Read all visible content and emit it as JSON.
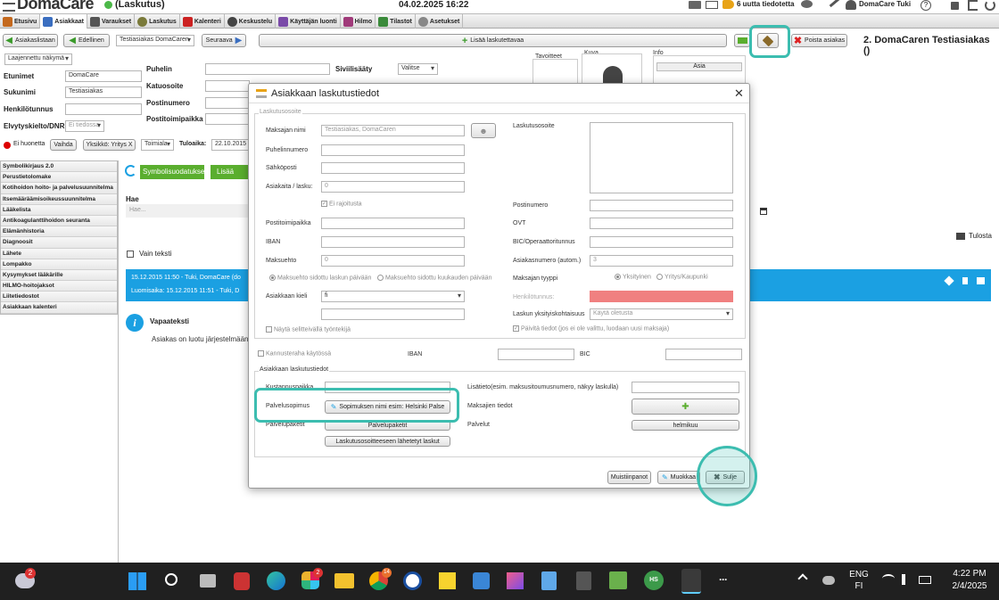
{
  "app": {
    "title": "DomaCare",
    "mode": "(Laskutus)",
    "datetime": "04.02.2025 16:22",
    "notifications": "6 uutta tiedotetta",
    "user": "DomaCare Tuki"
  },
  "tabs": [
    "Etusivu",
    "Asiakkaat",
    "Varaukset",
    "Laskutus",
    "Kalenteri",
    "Keskustelu",
    "Käyttäjän luonti",
    "Hilmo",
    "Tilastot",
    "Asetukset"
  ],
  "toolbar": {
    "back_list": "Asiakaslistaan",
    "prev": "Edellinen",
    "client_select": "Testiasiakas DomaCaren",
    "next": "Seuraava",
    "add_billable": "Lisää laskutettavaa",
    "remove_client": "Poista asiakas",
    "client_heading": "2. DomaCaren Testiasiakas ()"
  },
  "client": {
    "view_select": "Laajennettu näkymä",
    "labels": {
      "firstname": "Etunimet",
      "lastname": "Sukunimi",
      "ssn": "Henkilötunnus",
      "revival": "Elvytyskielto/DNR",
      "phone": "Puhelin",
      "street": "Katuosoite",
      "postcode": "Postinumero",
      "postoffice": "Postitoimipaikka",
      "marital": "Siviilisääty",
      "goals": "Tavoitteet",
      "image": "Kuva",
      "info": "Info"
    },
    "values": {
      "firstname": "DomaCare",
      "lastname": "Testiasiakas",
      "revival": "Ei tiedossa",
      "marital": "Valitse"
    },
    "info_col": "Asia",
    "concern": "Ei huonetta",
    "change_btn": "Vaihda",
    "unit": "Yksikkö: Yritys X",
    "office": "Toimiala",
    "arrival_label": "Tuloaika:",
    "arrival": "22.10.2015"
  },
  "sidebar": [
    "Symbolikirjaus 2.0",
    "Perustietolomake",
    "Kotihoidon hoito- ja palvelusuunnitelma",
    "Itsemääräämisoikeussuunnitelma",
    "Lääkelista",
    "Antikoagulanttihoidon seuranta",
    "Elämänhistoria",
    "Diagnoosit",
    "Lähete",
    "Lompakko",
    "Kysymykset lääkärille",
    "HILMO-hoitojaksot",
    "Liitetiedostot",
    "Asiakkaan kalenteri"
  ],
  "main": {
    "symbol_filter": "Symbolisuodatukset",
    "add_report": "Lisää rapo",
    "search_label": "Hae",
    "search_placeholder": "Hae...",
    "only_text": "Vain teksti",
    "print": "Tulosta",
    "entry_line1": "15.12.2015 11:50 - Tuki, DomaCare (do",
    "entry_line2": "Luomisaika: 15.12.2015 11:51 - Tuki, D",
    "free_text_title": "Vapaateksti",
    "free_text": "Asiakas on luotu järjestelmään"
  },
  "dialog": {
    "title": "Asiakkaan laskutustiedot",
    "billing_address_section": "Laskutusosoite",
    "payer_name_label": "Maksajan nimi",
    "payer_name_placeholder": "Testiasiakas, DomaCaren",
    "phone_label": "Puhelinnumero",
    "email_label": "Sähköposti",
    "invoice_time_label": "Asiakaita / lasku:",
    "invoice_time_value": "0",
    "unlimited": "Ei rajoitusta",
    "postoffice_label": "Postitoimipaikka",
    "iban_label": "IBAN",
    "payment_term_label": "Maksuehto",
    "payment_term_value": "0",
    "term_option1": "Maksuehto sidottu laskun päivään",
    "term_option2": "Maksuehto sidottu kuukauden päivään",
    "language_label": "Asiakkaan kieli",
    "language_value": "fi",
    "show_seller": "Näytä selitteivällä työntekijä",
    "billing_address_label": "Laskutusosoite",
    "postcode_label": "Postinumero",
    "ovt_label": "OVT",
    "bic_operator_label": "BIC/Operaattoritunnus",
    "customer_no_label": "Asiakasnumero (autom.)",
    "customer_no_value": "3",
    "payer_type_label": "Maksajan tyyppi",
    "type_private": "Yksityinen",
    "type_company": "Yritys/Kaupunki",
    "ssn_label": "Henkilötunnus:",
    "privacy_label": "Laskun yksityiskohtaisuus",
    "privacy_value": "Käytä oletusta",
    "update_info": "Päivitä tiedot (jos ei ole valittu, luodaan uusi maksaja)",
    "kanta_label": "Kannusteraha käytössä",
    "iban2_label": "IBAN",
    "bic_label": "BIC",
    "client_billing_section": "Asiakkaan laskutustiedot",
    "cost_center_label": "Kustannuspaikka",
    "extra_info_label": "Lisätieto(esim. maksusitoumusnumero, näkyy laskulla)",
    "service_contract_label": "Palvelusopimus",
    "service_contract_btn": "Sopimuksen nimi esim: Helsinki Palse",
    "payers_label": "Maksajien tiedot",
    "service_packages_label": "Palvelupaketit",
    "service_packages_btn": "Palvelupaketit",
    "services_label": "Palvelut",
    "services_btn": "helmikuu",
    "sent_invoices_btn": "Laskutusosoitteeseen lähetetyt laskut",
    "notes_btn": "Muistiinpanot",
    "edit_btn": "Muokkaa",
    "close_btn": "Sulje"
  },
  "taskbar": {
    "lang": "ENG",
    "region": "FI",
    "time": "4:22 PM",
    "date": "2/4/2025",
    "weather_badge": "2",
    "badge_app1": "2",
    "badge_app2": "14"
  },
  "colors": {
    "accent": "#3cbdb0",
    "banner": "#1ba0e2",
    "green": "#5aae2e",
    "error": "#f08080"
  }
}
